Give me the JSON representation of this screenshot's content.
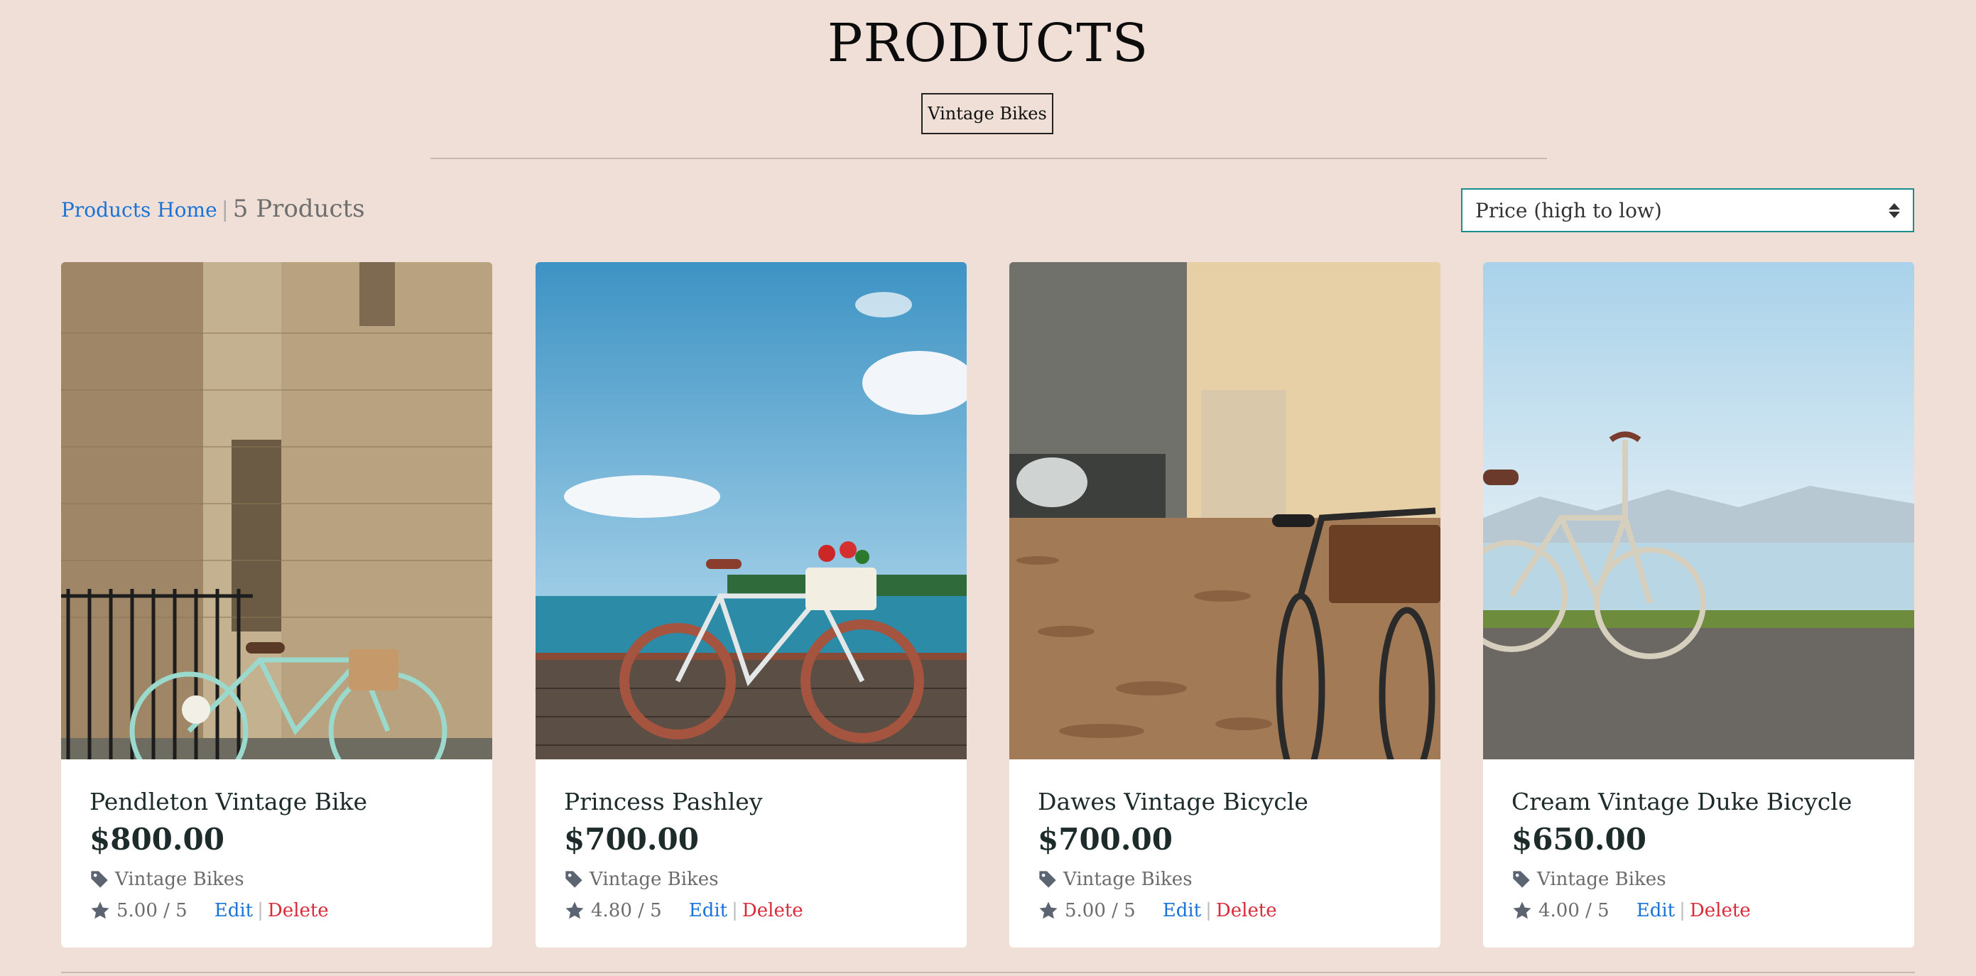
{
  "page": {
    "title": "PRODUCTS",
    "category_button": "Vintage Bikes"
  },
  "breadcrumb": {
    "home": "Products Home",
    "separator": "|",
    "count": "5 Products"
  },
  "sort": {
    "selected": "Price (high to low)"
  },
  "products": [
    {
      "name": "Pendleton Vintage Bike",
      "price": "$800.00",
      "category": "Vintage Bikes",
      "rating": "5.00 / 5",
      "edit": "Edit",
      "separator": "|",
      "delete": "Delete"
    },
    {
      "name": "Princess Pashley",
      "price": "$700.00",
      "category": "Vintage Bikes",
      "rating": "4.80 / 5",
      "edit": "Edit",
      "separator": "|",
      "delete": "Delete"
    },
    {
      "name": "Dawes Vintage Bicycle",
      "price": "$700.00",
      "category": "Vintage Bikes",
      "rating": "5.00 / 5",
      "edit": "Edit",
      "separator": "|",
      "delete": "Delete"
    },
    {
      "name": "Cream Vintage Duke Bicycle",
      "price": "$650.00",
      "category": "Vintage Bikes",
      "rating": "4.00 / 5",
      "edit": "Edit",
      "separator": "|",
      "delete": "Delete"
    }
  ],
  "icons": {
    "tag": "tag-icon",
    "star": "star-icon",
    "sort": "sort-arrows-icon"
  },
  "colors": {
    "background": "#efdfd7",
    "link": "#1a73d9",
    "delete": "#d92b3a",
    "select_border": "#1c8c8c"
  }
}
